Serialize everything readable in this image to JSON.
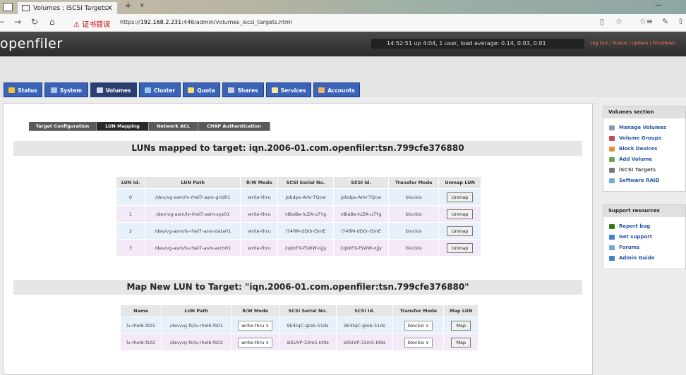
{
  "browser": {
    "tab_title": "Volumes : iSCSI Targets",
    "tab_close": "✕",
    "new_tab": "+",
    "tab_menu": "∨",
    "back": "←",
    "forward": "→",
    "reload": "↻",
    "home": "⌂",
    "cert_warning": "⚠ 证书错误",
    "url_prefix": "https://",
    "url_host": "192.168.2.231",
    "url_rest": ":446/admin/volumes_iscsi_targets.html",
    "reading_view": "▯",
    "favorite": "☆",
    "favorites": "☆≡",
    "notes": "✎",
    "share": "⇧",
    "minimize": "—"
  },
  "header": {
    "logo": "openfiler",
    "uptime": "14:52:51 up 4:04, 1 user, load average: 0.14, 0.03, 0.01",
    "links": [
      "Log Out",
      "Status",
      "Update",
      "Shutdown"
    ]
  },
  "main_tabs": [
    {
      "label": "Status",
      "icon": "status-icon",
      "color": "#f1c232"
    },
    {
      "label": "System",
      "icon": "system-icon",
      "color": "#a8c4e8"
    },
    {
      "label": "Volumes",
      "icon": "volumes-icon",
      "color": "#cfd8e6"
    },
    {
      "label": "Cluster",
      "icon": "cluster-icon",
      "color": "#9fc5e8"
    },
    {
      "label": "Quota",
      "icon": "quota-icon",
      "color": "#ffd966"
    },
    {
      "label": "Shares",
      "icon": "shares-icon",
      "color": "#cfcfcf"
    },
    {
      "label": "Services",
      "icon": "services-icon",
      "color": "#ffe599"
    },
    {
      "label": "Accounts",
      "icon": "accounts-icon",
      "color": "#f6b26b"
    }
  ],
  "active_main_tab": "Volumes",
  "sub_tabs": [
    "Target Configuration",
    "LUN Mapping",
    "Network ACL",
    "CHAP Authentication"
  ],
  "active_sub_tab": "LUN Mapping",
  "mapped": {
    "title": "LUNs mapped to target: iqn.2006-01.com.openfiler:tsn.799cfe376880",
    "columns": [
      "LUN Id.",
      "LUN Path",
      "R/W Mode",
      "SCSI Serial No.",
      "SCSI Id.",
      "Transfer Mode",
      "Unmap LUN"
    ],
    "rows": [
      {
        "id": "0",
        "path": "/dev/vg-asm/lv-rhel7-asm-grid01",
        "mode": "write-thru",
        "serial": "Jobdpx-Arkr-TQcw",
        "scsi_id": "Jobdpx-Arkr-TQcw",
        "transfer": "blockio",
        "action": "Unmap"
      },
      {
        "id": "1",
        "path": "/dev/vg-asm/lv-rhel7-asm-sys01",
        "mode": "write-thru",
        "serial": "vBlaBe-luZA-u7Yg",
        "scsi_id": "vBlaBe-luZA-u7Yg",
        "transfer": "blockio",
        "action": "Unmap"
      },
      {
        "id": "2",
        "path": "/dev/vg-asm/lv-rhel7-asm-data01",
        "mode": "write-thru",
        "serial": "I74fIM-dD0r-iSmE",
        "scsi_id": "I74fIM-dD0r-iSmE",
        "transfer": "blockio",
        "action": "Unmap"
      },
      {
        "id": "3",
        "path": "/dev/vg-asm/lv-rhel7-asm-arch01",
        "mode": "write-thru",
        "serial": "2qkkFX-f5WW-njjy",
        "scsi_id": "2qkkFX-f5WW-njjy",
        "transfer": "blockio",
        "action": "Unmap"
      }
    ]
  },
  "map_new": {
    "title": "Map New LUN to Target: \"iqn.2006-01.com.openfiler:tsn.799cfe376880\"",
    "columns": [
      "Name",
      "LUN Path",
      "R/W Mode",
      "SCSI Serial No.",
      "SCSI Id.",
      "Transfer Mode",
      "Map LUN"
    ],
    "rows": [
      {
        "name": "lv-rhel6-fs01",
        "path": "/dev/vg-fs/lv-rhel6-fs01",
        "mode": "write-thru",
        "serial": "9E4tqC-gteb-51ds",
        "scsi_id": "9E4tqC-gteb-51ds",
        "transfer": "blockio",
        "action": "Map"
      },
      {
        "name": "lv-rhel6-fs02",
        "path": "/dev/vg-fs/lv-rhel6-fs02",
        "mode": "write-thru",
        "serial": "sISUVP-33m5-kt9s",
        "scsi_id": "sISUVP-33m5-kt9s",
        "transfer": "blockio",
        "action": "Map"
      }
    ]
  },
  "sidebar": {
    "volumes_title": "Volumes section",
    "volumes_items": [
      {
        "label": "Manage Volumes",
        "icon": "manage-volumes-icon",
        "color": "#8a9bb0"
      },
      {
        "label": "Volume Groups",
        "icon": "volume-groups-icon",
        "color": "#c0504d"
      },
      {
        "label": "Block Devices",
        "icon": "block-devices-icon",
        "color": "#e69138"
      },
      {
        "label": "Add Volume",
        "icon": "add-volume-icon",
        "color": "#6aa84f"
      },
      {
        "label": "iSCSI Targets",
        "icon": "iscsi-targets-icon",
        "color": "#777777"
      },
      {
        "label": "Software RAID",
        "icon": "software-raid-icon",
        "color": "#6fa8dc"
      }
    ],
    "support_title": "Support resources",
    "support_items": [
      {
        "label": "Report bug",
        "icon": "report-bug-icon",
        "color": "#38761d"
      },
      {
        "label": "Get support",
        "icon": "get-support-icon",
        "color": "#3d85c6"
      },
      {
        "label": "Forums",
        "icon": "forums-icon",
        "color": "#6fa8dc"
      },
      {
        "label": "Admin Guide",
        "icon": "admin-guide-icon",
        "color": "#3d85c6"
      }
    ]
  }
}
